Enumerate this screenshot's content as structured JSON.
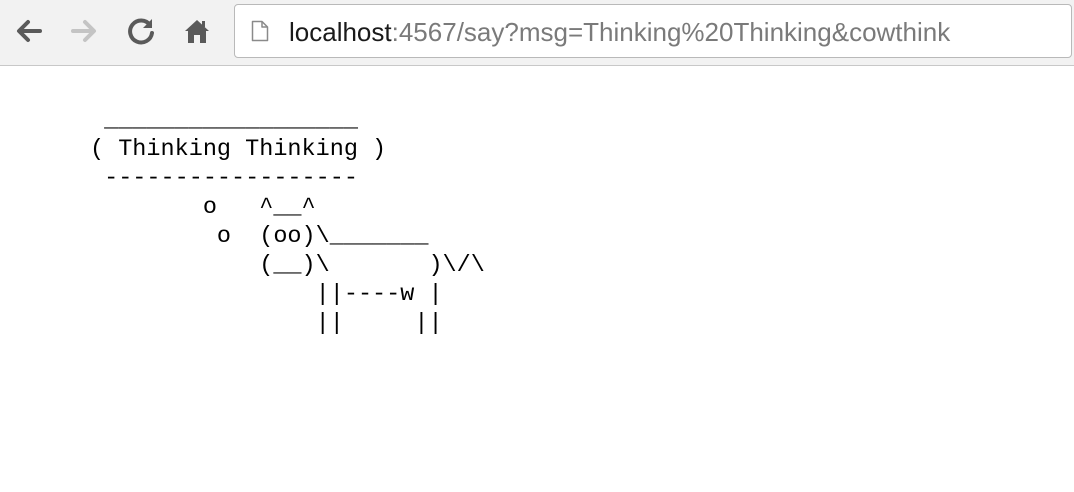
{
  "browser": {
    "nav": {
      "back_icon": "arrow-left-icon",
      "forward_icon": "arrow-right-icon",
      "reload_icon": "reload-icon",
      "home_icon": "home-icon"
    },
    "address_bar": {
      "host": "localhost",
      "rest": ":4567/say?msg=Thinking%20Thinking&cowthink",
      "page_icon": "page-icon"
    },
    "colors": {
      "toolbar_bg": "#f2f2f2",
      "icon_active": "#5a5a5a",
      "icon_disabled": "#c4c4c4"
    }
  },
  "page": {
    "cowsay_text": " __________________\n( Thinking Thinking )\n ------------------\n        o   ^__^\n         o  (oo)\\_______\n            (__)\\       )\\/\\\n                ||----w |\n                ||     ||"
  }
}
